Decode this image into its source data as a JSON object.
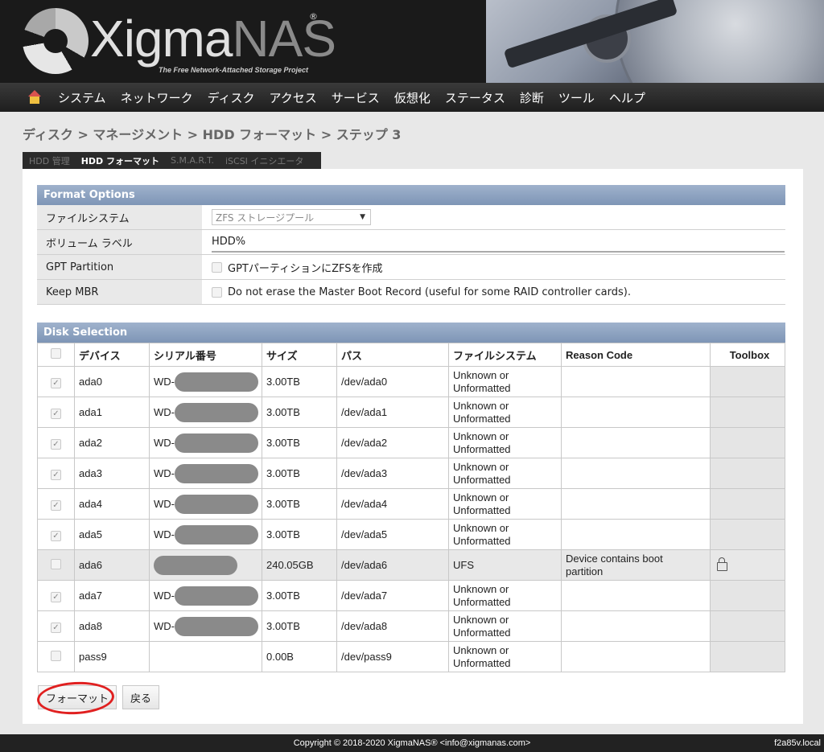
{
  "header": {
    "logo_text_1": "Xigma",
    "logo_text_2": "NAS",
    "logo_reg": "®",
    "tagline": "The Free Network-Attached Storage Project"
  },
  "nav": [
    "システム",
    "ネットワーク",
    "ディスク",
    "アクセス",
    "サービス",
    "仮想化",
    "ステータス",
    "診断",
    "ツール",
    "ヘルプ"
  ],
  "breadcrumb": "ディスク > マネージメント > HDD フォーマット > ステップ 3",
  "tabs": [
    {
      "label": "HDD 管理",
      "active": false
    },
    {
      "label": "HDD フォーマット",
      "active": true
    },
    {
      "label": "S.M.A.R.T.",
      "active": false
    },
    {
      "label": "iSCSI イニシエータ",
      "active": false
    }
  ],
  "format_options": {
    "title": "Format Options",
    "filesystem_label": "ファイルシステム",
    "filesystem_value": "ZFS ストレージプール",
    "volume_label": "ボリューム ラベル",
    "volume_value": "HDD%",
    "gpt_label": "GPT Partition",
    "gpt_text": "GPTパーティションにZFSを作成",
    "mbr_label": "Keep MBR",
    "mbr_text": "Do not erase the Master Boot Record (useful for some RAID controller cards)."
  },
  "disk_selection": {
    "title": "Disk Selection",
    "columns": [
      "デバイス",
      "シリアル番号",
      "サイズ",
      "パス",
      "ファイルシステム",
      "Reason Code",
      "Toolbox"
    ],
    "rows": [
      {
        "checked": true,
        "device": "ada0",
        "serial": "WD-",
        "size": "3.00TB",
        "path": "/dev/ada0",
        "fs1": "Unknown or",
        "fs2": "Unformatted",
        "reason1": "",
        "reason2": "",
        "lock": false
      },
      {
        "checked": true,
        "device": "ada1",
        "serial": "WD-",
        "size": "3.00TB",
        "path": "/dev/ada1",
        "fs1": "Unknown or",
        "fs2": "Unformatted",
        "reason1": "",
        "reason2": "",
        "lock": false
      },
      {
        "checked": true,
        "device": "ada2",
        "serial": "WD-",
        "size": "3.00TB",
        "path": "/dev/ada2",
        "fs1": "Unknown or",
        "fs2": "Unformatted",
        "reason1": "",
        "reason2": "",
        "lock": false
      },
      {
        "checked": true,
        "device": "ada3",
        "serial": "WD-",
        "size": "3.00TB",
        "path": "/dev/ada3",
        "fs1": "Unknown or",
        "fs2": "Unformatted",
        "reason1": "",
        "reason2": "",
        "lock": false
      },
      {
        "checked": true,
        "device": "ada4",
        "serial": "WD-",
        "size": "3.00TB",
        "path": "/dev/ada4",
        "fs1": "Unknown or",
        "fs2": "Unformatted",
        "reason1": "",
        "reason2": "",
        "lock": false
      },
      {
        "checked": true,
        "device": "ada5",
        "serial": "WD-",
        "size": "3.00TB",
        "path": "/dev/ada5",
        "fs1": "Unknown or",
        "fs2": "Unformatted",
        "reason1": "",
        "reason2": "",
        "lock": false
      },
      {
        "checked": false,
        "device": "ada6",
        "serial": "",
        "size": "240.05GB",
        "path": "/dev/ada6",
        "fs1": "UFS",
        "fs2": "",
        "reason1": "Device contains boot",
        "reason2": "partition",
        "lock": true,
        "disabled": true
      },
      {
        "checked": true,
        "device": "ada7",
        "serial": "WD-",
        "size": "3.00TB",
        "path": "/dev/ada7",
        "fs1": "Unknown or",
        "fs2": "Unformatted",
        "reason1": "",
        "reason2": "",
        "lock": false
      },
      {
        "checked": true,
        "device": "ada8",
        "serial": "WD-",
        "size": "3.00TB",
        "path": "/dev/ada8",
        "fs1": "Unknown or",
        "fs2": "Unformatted",
        "reason1": "",
        "reason2": "",
        "lock": false
      },
      {
        "checked": false,
        "device": "pass9",
        "serial": "",
        "size": "0.00B",
        "path": "/dev/pass9",
        "fs1": "Unknown or",
        "fs2": "Unformatted",
        "reason1": "",
        "reason2": "",
        "lock": false,
        "no_redact": true
      }
    ]
  },
  "buttons": {
    "format": "フォーマット",
    "back": "戻る"
  },
  "footer": {
    "copyright": "Copyright © 2018-2020 XigmaNAS® <info@xigmanas.com>",
    "host": "f2a85v.local"
  },
  "colors": {
    "section_header": "#8da3c2",
    "annotation_circle": "#e02020"
  }
}
